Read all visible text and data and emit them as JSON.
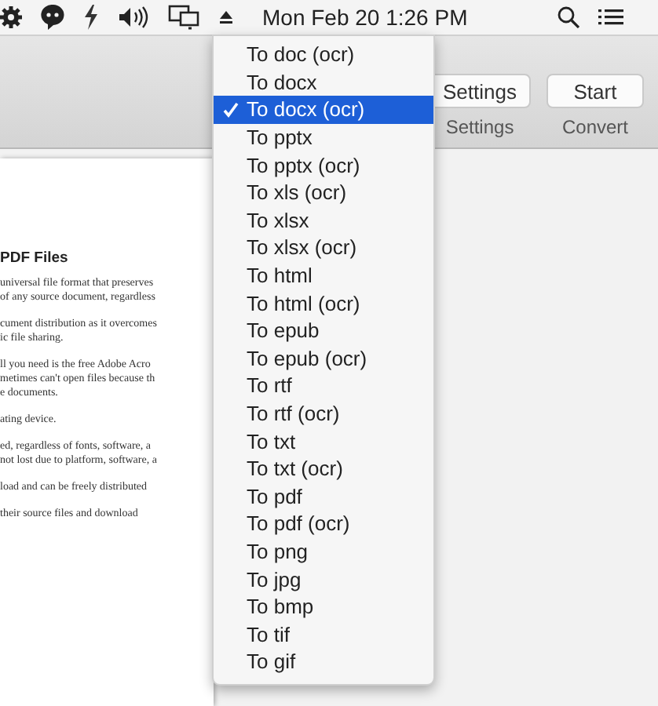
{
  "menu_bar": {
    "clock": "Mon Feb 20  1:26 PM"
  },
  "toolbar": {
    "buttons": [
      {
        "label": "Settings",
        "caption": "Settings"
      },
      {
        "label": "Start",
        "caption": "Convert"
      }
    ]
  },
  "document": {
    "heading": "PDF Files",
    "paragraphs": [
      [
        "universal file format that preserves",
        "of any source document, regardless"
      ],
      [
        "cument distribution as it overcomes",
        "ic file sharing."
      ],
      [
        "ll you need is the free Adobe Acro",
        "metimes can't open files because th",
        "e documents."
      ],
      [
        "ating device."
      ],
      [
        "ed, regardless of fonts, software, a",
        "not lost due to platform, software, a"
      ],
      [
        "load and can be freely distributed"
      ],
      [
        "their source files and download"
      ]
    ]
  },
  "format_menu": {
    "items": [
      {
        "label": "To doc (ocr)",
        "selected": false
      },
      {
        "label": "To docx",
        "selected": false
      },
      {
        "label": "To docx (ocr)",
        "selected": true
      },
      {
        "label": "To pptx",
        "selected": false
      },
      {
        "label": "To pptx (ocr)",
        "selected": false
      },
      {
        "label": "To xls (ocr)",
        "selected": false
      },
      {
        "label": "To xlsx",
        "selected": false
      },
      {
        "label": "To xlsx (ocr)",
        "selected": false
      },
      {
        "label": "To html",
        "selected": false
      },
      {
        "label": "To html (ocr)",
        "selected": false
      },
      {
        "label": "To epub",
        "selected": false
      },
      {
        "label": "To epub (ocr)",
        "selected": false
      },
      {
        "label": "To rtf",
        "selected": false
      },
      {
        "label": "To rtf (ocr)",
        "selected": false
      },
      {
        "label": "To txt",
        "selected": false
      },
      {
        "label": "To txt (ocr)",
        "selected": false
      },
      {
        "label": "To pdf",
        "selected": false
      },
      {
        "label": "To pdf (ocr)",
        "selected": false
      },
      {
        "label": "To png",
        "selected": false
      },
      {
        "label": "To jpg",
        "selected": false
      },
      {
        "label": "To bmp",
        "selected": false
      },
      {
        "label": "To tif",
        "selected": false
      },
      {
        "label": "To gif",
        "selected": false
      }
    ]
  }
}
